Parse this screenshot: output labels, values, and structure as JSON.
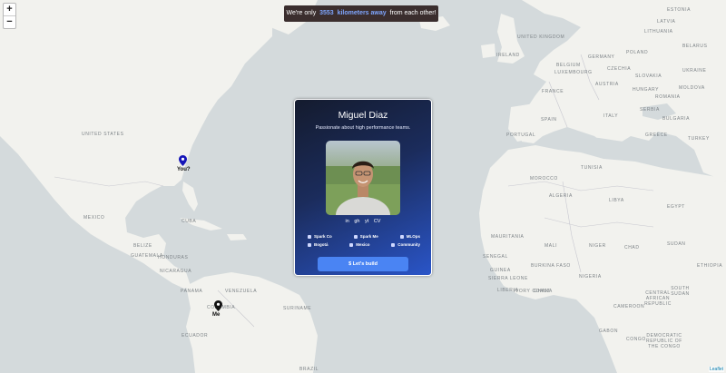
{
  "banner": {
    "prefix": "We're only",
    "distance": "3553",
    "unit": "kilometers away",
    "suffix": "from each other!"
  },
  "zoom": {
    "in": "+",
    "out": "−"
  },
  "markers": {
    "you": "You?",
    "me": "Me"
  },
  "map_labels": {
    "united_states": "UNITED STATES",
    "mexico": "MEXICO",
    "cuba": "CUBA",
    "belize": "BELIZE",
    "guatemala": "GUATEMALA",
    "honduras": "HONDURAS",
    "nicaragua": "NICARAGUA",
    "panama": "PANAMA",
    "venezuela": "VENEZUELA",
    "colombia": "COLOMBIA",
    "suriname": "SURINAME",
    "brazil": "BRAZIL",
    "ecuador": "ECUADOR",
    "united_kingdom": "UNITED KINGDOM",
    "ireland": "IRELAND",
    "belgium": "BELGIUM",
    "luxembourg": "LUXEMBOURG",
    "germany": "GERMANY",
    "poland": "POLAND",
    "czechia": "CZECHIA",
    "slovakia": "SLOVAKIA",
    "austria": "AUSTRIA",
    "hungary": "HUNGARY",
    "romania": "ROMANIA",
    "moldova": "MOLDOVA",
    "ukraine": "UKRAINE",
    "belarus": "BELARUS",
    "lithuania": "LITHUANIA",
    "latvia": "LATVIA",
    "estonia": "ESTONIA",
    "france": "FRANCE",
    "serbia": "SERBIA",
    "bulgaria": "BULGARIA",
    "portugal": "PORTUGAL",
    "spain": "SPAIN",
    "italy": "ITALY",
    "greece": "GREECE",
    "turkey": "TURKEY",
    "tunisia": "TUNISIA",
    "morocco": "MOROCCO",
    "algeria": "ALGERIA",
    "libya": "LIBYA",
    "egypt": "EGYPT",
    "mauritania": "MAURITANIA",
    "mali": "MALI",
    "niger": "NIGER",
    "chad": "CHAD",
    "sudan": "SUDAN",
    "senegal": "SENEGAL",
    "guinea": "GUINEA",
    "burkina_faso": "BURKINA FASO",
    "nigeria": "NIGERIA",
    "ivory_coast": "IVORY COAST",
    "ghana": "GHANA",
    "sierra_leone": "SIERRA LEONE",
    "liberia": "LIBERIA",
    "cameroon": "CAMEROON",
    "car": "CENTRAL AFRICAN REPUBLIC",
    "south_sudan": "SOUTH SUDAN",
    "gabon": "GABON",
    "congo": "CONGO",
    "drc": "DEMOCRATIC REPUBLIC OF THE CONGO",
    "ethiopia": "ETHIOPIA"
  },
  "card": {
    "name": "Miguel Diaz",
    "tagline": "Passionate about high performance teams.",
    "social": [
      "in",
      "gh",
      "yt",
      "CV"
    ],
    "items": [
      [
        "Spark Co",
        "Spark Me",
        "MLOps"
      ],
      [
        "Bogotá",
        "Mexico",
        "Community"
      ]
    ],
    "cta": "$ Let's build"
  },
  "attribution": "Leaflet"
}
